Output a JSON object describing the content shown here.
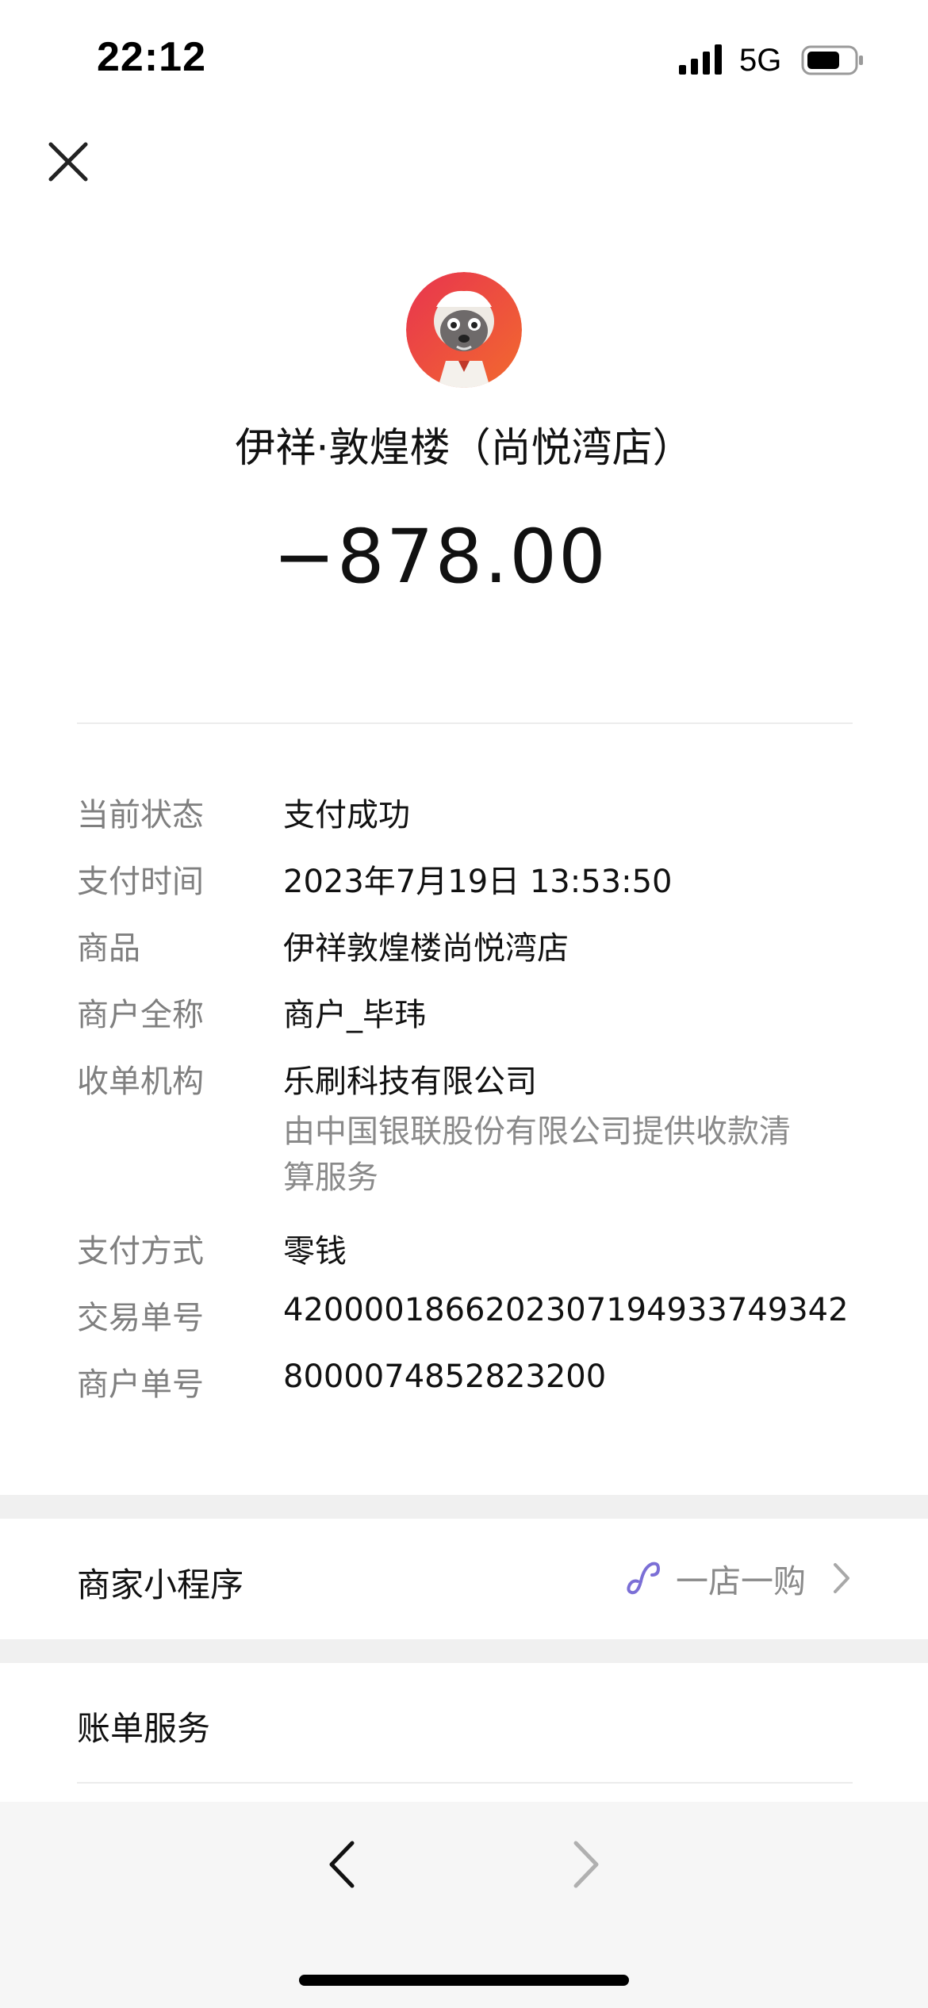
{
  "status_bar": {
    "time": "22:12",
    "network": "5G"
  },
  "merchant": {
    "name": "伊祥·敦煌楼（尚悦湾店）",
    "amount": "−878.00"
  },
  "details": [
    {
      "label": "当前状态",
      "value": "支付成功"
    },
    {
      "label": "支付时间",
      "value": "2023年7月19日 13:53:50"
    },
    {
      "label": "商品",
      "value": "伊祥敦煌楼尚悦湾店"
    },
    {
      "label": "商户全称",
      "value": "商户_毕玮"
    },
    {
      "label": "收单机构",
      "value": "乐刷科技有限公司",
      "note_line1": "由中国银联股份有限公司提供收款清",
      "note_line2": "算服务"
    },
    {
      "label": "支付方式",
      "value": "零钱"
    },
    {
      "label": "交易单号",
      "value": "4200001866202307194933749342"
    },
    {
      "label": "商户单号",
      "value": "8000074852823200"
    }
  ],
  "mini_program": {
    "title": "商家小程序",
    "link_label": "一店一购"
  },
  "bill_service": {
    "title": "账单服务"
  },
  "icons": {
    "close": "close-icon",
    "link": "link-icon",
    "chevron": "chevron-right-icon",
    "back": "back-icon",
    "forward": "forward-icon"
  },
  "colors": {
    "link_icon": "#7b6fd6",
    "muted_text": "#8a8a8a",
    "label_text": "#7f7f7f",
    "band": "#f0f0f0"
  }
}
